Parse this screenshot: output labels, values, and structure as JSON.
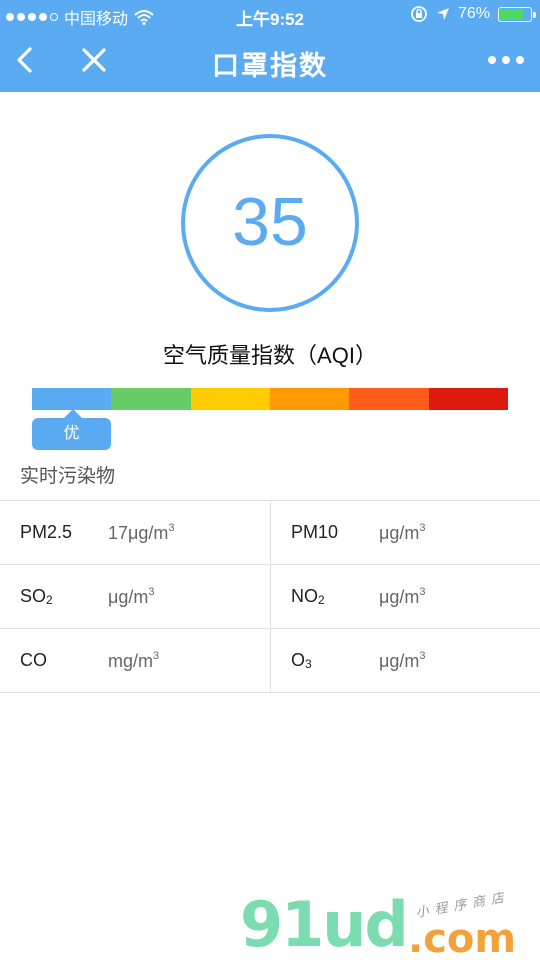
{
  "status": {
    "carrier": "中国移动",
    "time": "上午9:52",
    "battery": "76%",
    "battery_level": 0.76
  },
  "nav": {
    "title": "口罩指数"
  },
  "aqi": {
    "value": "35",
    "label": "空气质量指数（AQI）",
    "level": "优"
  },
  "scale_colors": [
    "#5aabf2",
    "#66cc66",
    "#ffcc00",
    "#ff9900",
    "#ff5c1a",
    "#dd1a0d"
  ],
  "pollutants_title": "实时污染物",
  "pollutants": {
    "pm25": {
      "name": "PM2.5",
      "value": "17μg/m",
      "exp": "3"
    },
    "pm10": {
      "name": "PM10",
      "value": "μg/m",
      "exp": "3"
    },
    "so2": {
      "name": "SO",
      "sub": "2",
      "value": "μg/m",
      "exp": "3"
    },
    "no2": {
      "name": "NO",
      "sub": "2",
      "value": "μg/m",
      "exp": "3"
    },
    "co": {
      "name": "CO",
      "value": "mg/m",
      "exp": "3"
    },
    "o3": {
      "name": "O",
      "sub": "3",
      "value": "μg/m",
      "exp": "3"
    }
  },
  "watermark": {
    "main": "91ud",
    "domain": ".com",
    "tagline": "小程序商店"
  }
}
